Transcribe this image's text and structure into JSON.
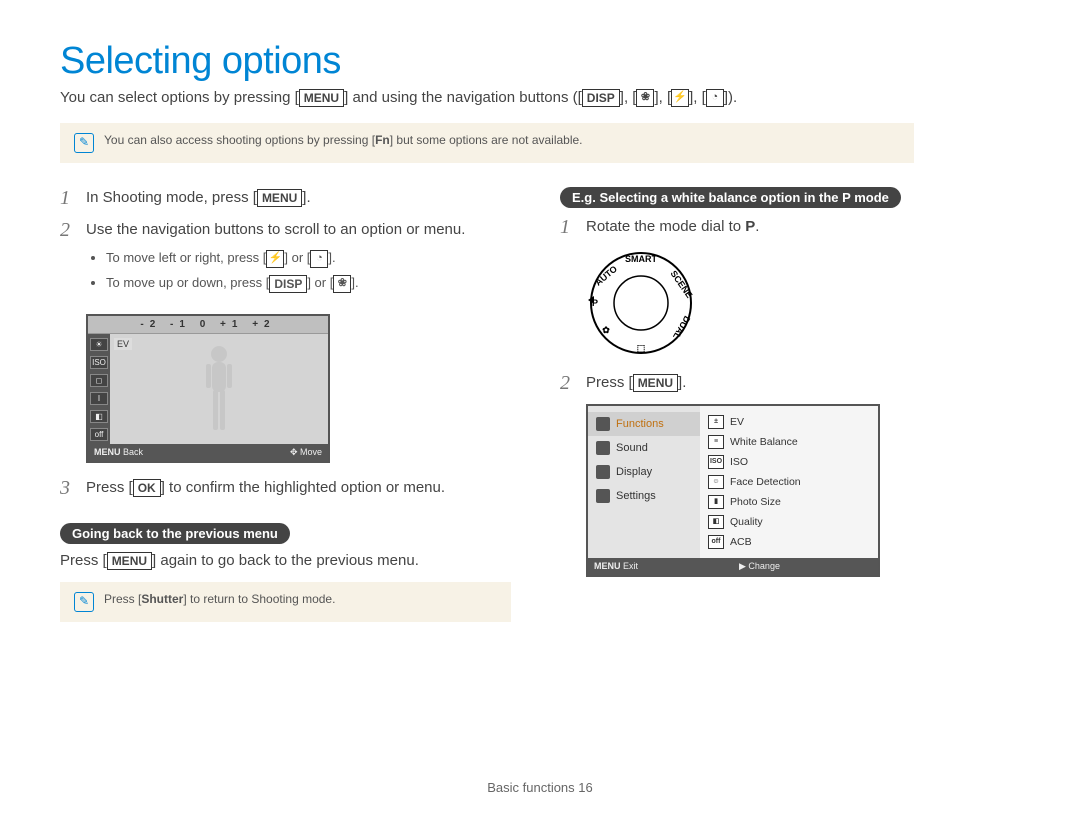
{
  "title": "Selecting options",
  "intro_a": "You can select options by pressing [",
  "intro_menu": "MENU",
  "intro_b": "] and using the navigation buttons ([",
  "intro_disp": "DISP",
  "intro_c": "], [",
  "intro_d": "], [",
  "intro_e": "], [",
  "intro_f": "]).",
  "note1_a": "You can also access shooting options by pressing [",
  "note1_fn": "Fn",
  "note1_b": "] but some options are not available.",
  "left": {
    "s1_a": "In Shooting mode, press [",
    "s1_menu": "MENU",
    "s1_b": "].",
    "s2": "Use the navigation buttons to scroll to an option or menu.",
    "s2_bullet1_a": "To move left or right, press [",
    "s2_bullet1_b": "] or [",
    "s2_bullet1_c": "].",
    "s2_bullet2_a": "To move up or down, press [",
    "s2_bullet2_disp": "DISP",
    "s2_bullet2_b": "] or [",
    "s2_bullet2_c": "].",
    "s3_a": "Press [",
    "s3_ok": "OK",
    "s3_b": "] to confirm the highlighted option or menu.",
    "pill": "Going back to the previous menu",
    "back_a": "Press [",
    "back_menu": "MENU",
    "back_b": "] again to go back to the previous menu.",
    "note2_a": "Press [",
    "note2_shutter": "Shutter",
    "note2_b": "] to return to Shooting mode."
  },
  "lcd": {
    "scale": "-2   -1    0   +1   +2",
    "ev": "EV",
    "back_label": "MENU",
    "back_text": "Back",
    "move_text": "Move",
    "side_icons": [
      "☀",
      "ISO",
      "◻",
      "I",
      "◧",
      "off"
    ]
  },
  "right": {
    "pill": "E.g. Selecting a white balance option in the P mode",
    "s1_a": "Rotate the mode dial to ",
    "s1_p": "P",
    "s1_b": ".",
    "s2_a": "Press [",
    "s2_menu": "MENU",
    "s2_b": "]."
  },
  "menu": {
    "left_items": [
      "Functions",
      "Sound",
      "Display",
      "Settings"
    ],
    "right_items": [
      "EV",
      "White Balance",
      "ISO",
      "Face Detection",
      "Photo Size",
      "Quality",
      "ACB"
    ],
    "exit_label": "MENU",
    "exit_text": "Exit",
    "change_text": "Change"
  },
  "footer_a": "Basic functions",
  "footer_page": "16",
  "chart_data": {
    "type": "bar",
    "title": "EV exposure compensation scale",
    "categories": [
      "-2",
      "-1",
      "0",
      "+1",
      "+2"
    ],
    "values": [
      -2,
      -1,
      0,
      1,
      2
    ],
    "xlabel": "",
    "ylabel": "",
    "ylim": [
      -2,
      2
    ]
  }
}
